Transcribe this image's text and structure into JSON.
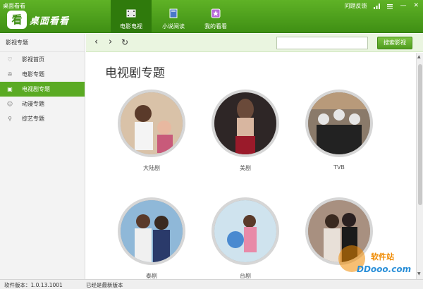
{
  "window": {
    "title": "桌面看看"
  },
  "app": {
    "logo_char": "看",
    "name": "桌面看看"
  },
  "tabs": [
    {
      "label": "电影电视",
      "active": true,
      "icon": "film-icon"
    },
    {
      "label": "小说阅读",
      "active": false,
      "icon": "book-icon"
    },
    {
      "label": "我的看看",
      "active": false,
      "icon": "star-icon"
    }
  ],
  "header_right": {
    "feedback": "问题反馈",
    "signal_icon": "signal-icon",
    "menu_icon": "menu-icon",
    "min": "—",
    "close": "✕"
  },
  "sidebar": {
    "title": "影视专题",
    "items": [
      {
        "label": "影视首页",
        "icon": "heart-icon",
        "glyph": "♡",
        "active": false
      },
      {
        "label": "电影专题",
        "icon": "film-reel-icon",
        "glyph": "✇",
        "active": false
      },
      {
        "label": "电视剧专题",
        "icon": "tv-icon",
        "glyph": "▣",
        "active": true
      },
      {
        "label": "动漫专题",
        "icon": "cartoon-icon",
        "glyph": "☺",
        "active": false
      },
      {
        "label": "综艺专题",
        "icon": "search-icon",
        "glyph": "⚲",
        "active": false
      }
    ]
  },
  "toolbar": {
    "back": "‹",
    "forward": "›",
    "refresh": "↻",
    "search_value": "",
    "search_button": "搜索影视"
  },
  "main": {
    "title": "电视剧专题",
    "cards": [
      {
        "label": "大陆剧",
        "color": "#c9a98a"
      },
      {
        "label": "美剧",
        "color": "#4a3a3a"
      },
      {
        "label": "TVB",
        "color": "#7a6a5a"
      },
      {
        "label": "泰剧",
        "color": "#6a8fb0"
      },
      {
        "label": "台剧",
        "color": "#b8d4e4"
      },
      {
        "label": "",
        "color": "#9a8070"
      }
    ]
  },
  "watermark": {
    "text_cn": "软件站",
    "url": "DDooo.com"
  },
  "status": {
    "version": "软件版本：1.0.13.1001",
    "message": "已经是最新版本"
  }
}
